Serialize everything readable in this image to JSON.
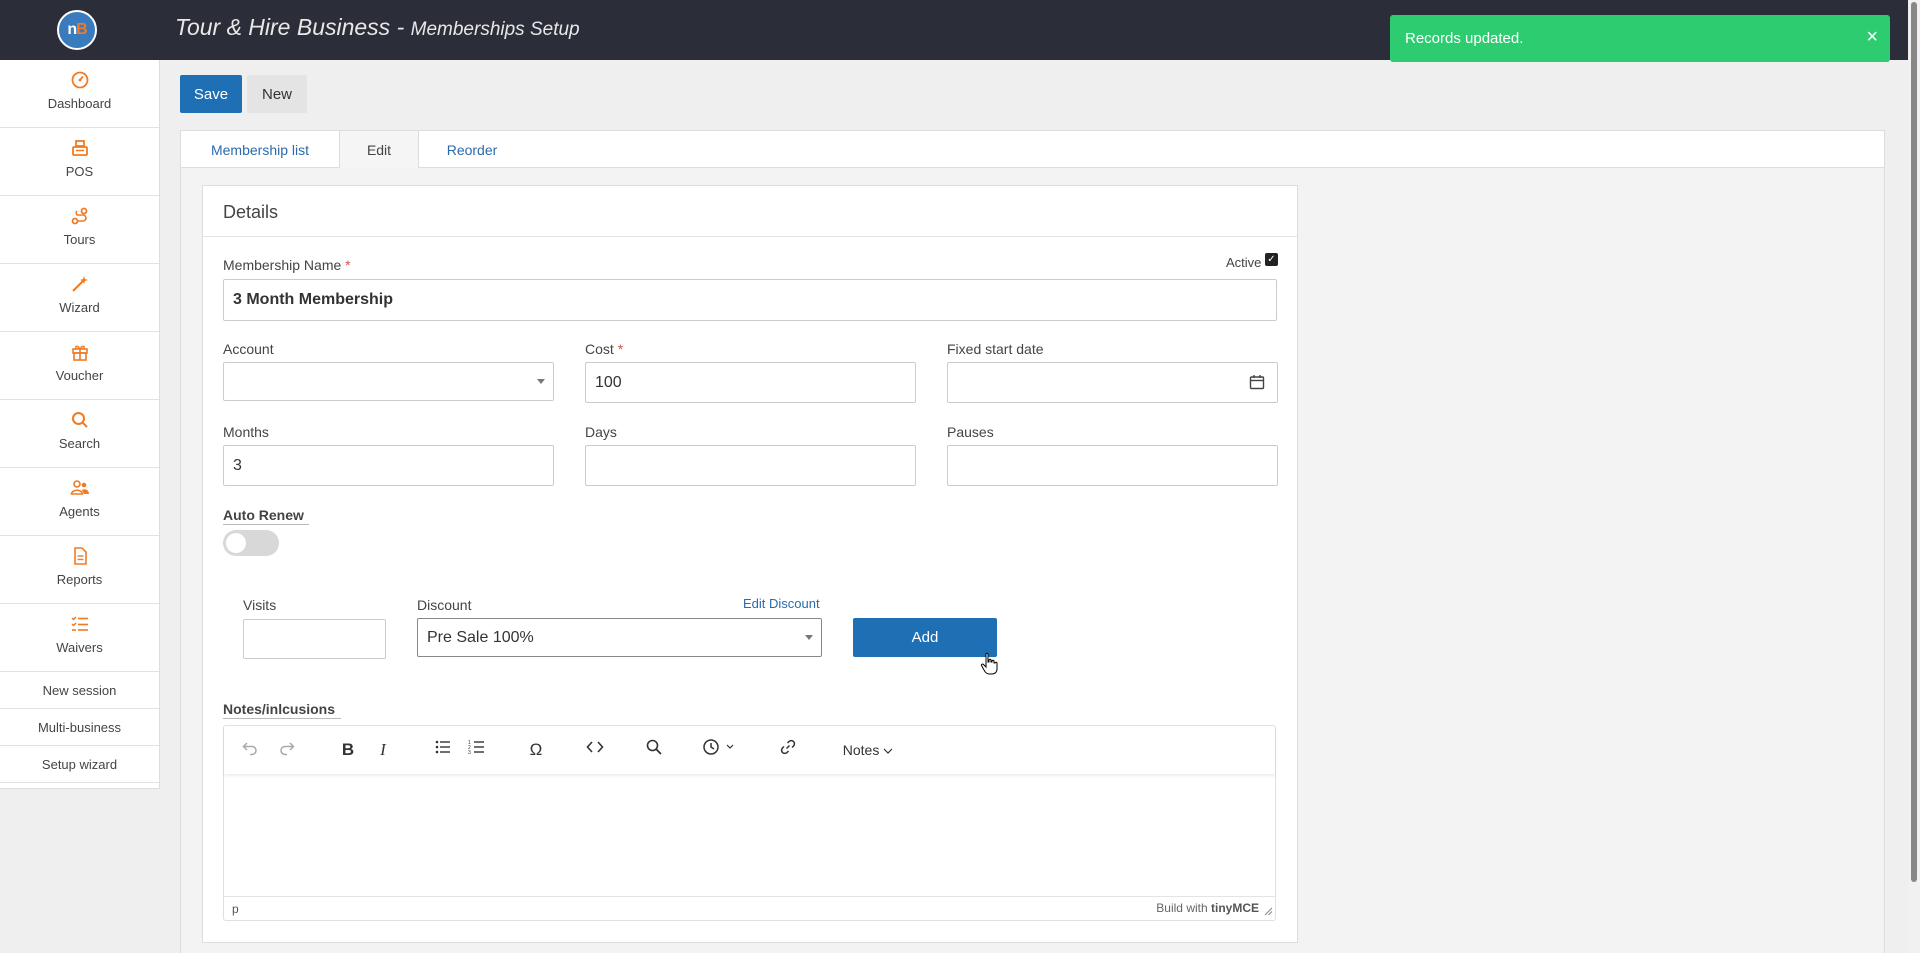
{
  "app": {
    "logo_text_1": "n",
    "logo_text_2": "B",
    "title": "Tour & Hire Business - ",
    "subtitle": "Memberships Setup"
  },
  "toast": {
    "message": "Records updated.",
    "close": "×",
    "color": "#2ecc71"
  },
  "sidebar": {
    "items": [
      {
        "label": "Dashboard",
        "icon": "dashboard-icon"
      },
      {
        "label": "POS",
        "icon": "register-icon"
      },
      {
        "label": "Tours",
        "icon": "route-icon"
      },
      {
        "label": "Wizard",
        "icon": "magic-wand-icon"
      },
      {
        "label": "Voucher",
        "icon": "gift-icon"
      },
      {
        "label": "Search",
        "icon": "search-icon"
      },
      {
        "label": "Agents",
        "icon": "users-icon"
      },
      {
        "label": "Reports",
        "icon": "report-icon"
      },
      {
        "label": "Waivers",
        "icon": "checklist-icon"
      }
    ],
    "links": [
      "New session",
      "Multi-business",
      "Setup wizard"
    ],
    "icon_color": "#f07b22"
  },
  "toolbar": {
    "save_label": "Save",
    "new_label": "New"
  },
  "tabs": [
    {
      "label": "Membership list"
    },
    {
      "label": "Edit"
    },
    {
      "label": "Reorder"
    }
  ],
  "details": {
    "heading": "Details",
    "active_label": "Active",
    "active_checked": true,
    "membership_name_label": "Membership Name",
    "membership_name_value": "3 Month Membership",
    "required_mark": "*",
    "account_label": "Account",
    "account_value": "",
    "cost_label": "Cost",
    "cost_value": "100",
    "fixed_start_label": "Fixed start date",
    "fixed_start_value": "",
    "months_label": "Months",
    "months_value": "3",
    "days_label": "Days",
    "days_value": "",
    "pauses_label": "Pauses",
    "pauses_value": "",
    "auto_renew_label": "Auto Renew",
    "auto_renew_on": false,
    "visits_label": "Visits",
    "visits_value": "",
    "discount_label": "Discount",
    "discount_value": "Pre Sale 100%",
    "edit_discount_label": "Edit Discount",
    "add_label": "Add",
    "notes_label": "Notes/inlcusions"
  },
  "editor": {
    "format_menu_label": "Notes",
    "statusbar_path": "p",
    "branding": "Build with",
    "branding_name": "tinyMCE"
  }
}
